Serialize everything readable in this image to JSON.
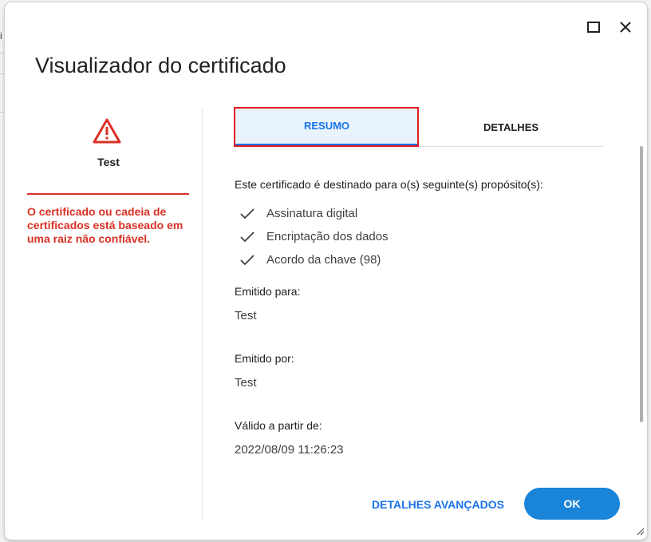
{
  "dialog": {
    "title": "Visualizador do certificado"
  },
  "left": {
    "cert_name": "Test",
    "warning": "O certificado ou cadeia de certificados está baseado em uma raiz não confiável.",
    "warning_color": "#d93025"
  },
  "tabs": [
    {
      "label": "RESUMO",
      "selected": true
    },
    {
      "label": "DETALHES",
      "selected": false
    }
  ],
  "summary": {
    "purpose_heading": "Este certificado é destinado para o(s) seguinte(s) propósito(s):",
    "purposes": [
      "Assinatura digital",
      "Encriptação dos dados",
      "Acordo da chave (98)"
    ],
    "issued_to_label": "Emitido para:",
    "issued_to_value": "Test",
    "issued_by_label": "Emitido por:",
    "issued_by_value": "Test",
    "valid_from_label": "Válido a partir de:",
    "valid_from_value": "2022/08/09 11:26:23"
  },
  "buttons": {
    "advanced": "DETALHES AVANÇADOS",
    "ok": "OK"
  },
  "icons": {
    "maximize": "maximize-icon",
    "close": "close-icon",
    "warning": "warning-triangle-icon",
    "check": "checkmark-icon",
    "resize": "resize-grip-icon"
  },
  "colors": {
    "accent": "#1a73e8",
    "primary_button": "#1a84d8",
    "highlight_box": "#e51c23"
  }
}
